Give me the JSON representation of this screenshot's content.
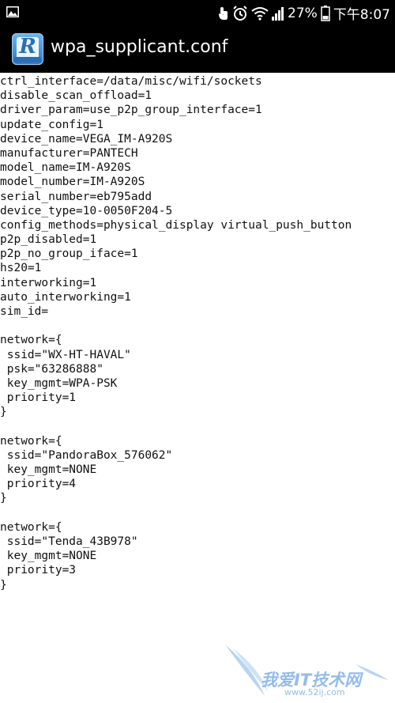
{
  "status_bar": {
    "battery_percent": "27%",
    "time": "下午8:07",
    "icons": [
      "image-icon",
      "touch-icon",
      "alarm-clock-icon",
      "wifi-icon",
      "signal-icon",
      "battery-icon"
    ]
  },
  "action_bar": {
    "app_icon_letter": "R",
    "title": "wpa_supplicant.conf"
  },
  "file_lines": [
    "ctrl_interface=/data/misc/wifi/sockets",
    "disable_scan_offload=1",
    "driver_param=use_p2p_group_interface=1",
    "update_config=1",
    "device_name=VEGA_IM-A920S",
    "manufacturer=PANTECH",
    "model_name=IM-A920S",
    "model_number=IM-A920S",
    "serial_number=eb795add",
    "device_type=10-0050F204-5",
    "config_methods=physical_display virtual_push_button",
    "p2p_disabled=1",
    "p2p_no_group_iface=1",
    "hs20=1",
    "interworking=1",
    "auto_interworking=1",
    "sim_id=",
    "",
    "network={",
    " ssid=\"WX-HT-HAVAL\"",
    " psk=\"63286888\"",
    " key_mgmt=WPA-PSK",
    " priority=1",
    "}",
    "",
    "network={",
    " ssid=\"PandoraBox_576062\"",
    " key_mgmt=NONE",
    " priority=4",
    "}",
    "",
    "network={",
    " ssid=\"Tenda_43B978\"",
    " key_mgmt=NONE",
    " priority=3",
    "}"
  ],
  "watermark": {
    "text": "我爱IT技术网",
    "url": "www.52ij.com"
  }
}
